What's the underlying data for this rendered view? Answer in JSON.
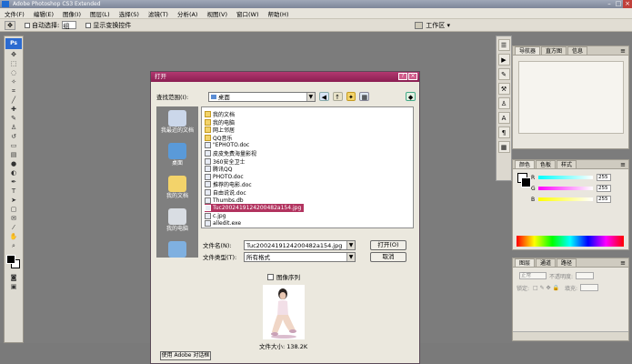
{
  "window": {
    "title": "Adobe Photoshop CS3 Extended"
  },
  "menubar": {
    "items": [
      "文件(F)",
      "编辑(E)",
      "图像(I)",
      "图层(L)",
      "选择(S)",
      "滤镜(T)",
      "分析(A)",
      "视图(V)",
      "窗口(W)",
      "帮助(H)"
    ]
  },
  "options_bar": {
    "auto_select_label": "自动选择:",
    "auto_select_value": "组",
    "show_transform_label": "显示变换控件",
    "workspace_label": "工作区 ▾"
  },
  "toolbox": {
    "logo": "Ps"
  },
  "panels": {
    "navigator_tabs": [
      "导航器",
      "直方图",
      "信息"
    ],
    "color_tabs": [
      "颜色",
      "色板",
      "样式"
    ],
    "color_sliders": [
      {
        "label": "R",
        "value": "255",
        "color": "#ff4040"
      },
      {
        "label": "G",
        "value": "255",
        "color": "#4cbf4c"
      },
      {
        "label": "B",
        "value": "255",
        "color": "#4c6ad8"
      }
    ],
    "layers_tabs": [
      "图层",
      "通道",
      "路径"
    ],
    "layers_mode": "正常",
    "opacity_label": "不透明度:",
    "lock_label": "锁定:",
    "fill_label": "填充:"
  },
  "dialog": {
    "title": "打开",
    "look_in_label": "查找范围(I):",
    "look_in_value": "桌面",
    "places": [
      "我最近的文档",
      "桌面",
      "我的文档",
      "我的电脑",
      ""
    ],
    "files": [
      {
        "name": "我的文档",
        "type": "folder"
      },
      {
        "name": "我的电脑",
        "type": "folder"
      },
      {
        "name": "网上邻居",
        "type": "folder"
      },
      {
        "name": "QQ音乐",
        "type": "folder"
      },
      {
        "name": "\"EPHOTO.doc",
        "type": "file"
      },
      {
        "name": "皮皮免费海量影视",
        "type": "file"
      },
      {
        "name": "360安全卫士",
        "type": "file"
      },
      {
        "name": "腾讯QQ",
        "type": "file"
      },
      {
        "name": "PHOTO.doc",
        "type": "file"
      },
      {
        "name": "推荐的电影.doc",
        "type": "file"
      },
      {
        "name": "自由说说.doc",
        "type": "file"
      },
      {
        "name": "Thumbs.db",
        "type": "file"
      },
      {
        "name": "Tuc2002419124200482a154.jpg",
        "type": "file",
        "selected": true
      },
      {
        "name": "c.jpg",
        "type": "file"
      },
      {
        "name": "alledit.exe",
        "type": "file"
      }
    ],
    "filename_label": "文件名(N):",
    "filename_value": "Tuc2002419124200482a154.jpg",
    "filetype_label": "文件类型(T):",
    "filetype_value": "所有格式",
    "open_button": "打开(O)",
    "cancel_button": "取消",
    "image_sequence_label": "图像序列",
    "filesize_text": "文件大小: 138.2K",
    "adobe_dialog_button": "使用 Adobe 对话框"
  }
}
